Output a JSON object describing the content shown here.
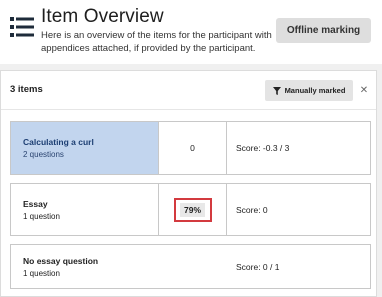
{
  "header": {
    "icon": "list-icon",
    "title": "Item Overview",
    "description": "Here is an overview of the items for the participant with appendices attached, if provided by the participant.",
    "offline_button": "Offline marking"
  },
  "toolbar": {
    "items_count": "3 items",
    "filter_icon": "filter-icon",
    "filter_label": "Manually marked",
    "filter_close": "✕"
  },
  "items": [
    {
      "title": "Calculating a curl",
      "subtitle": "2 questions",
      "count": "0",
      "score": "Score: -0.3 / 3"
    },
    {
      "title": "Essay",
      "subtitle": "1 question",
      "count": "79%",
      "score": "Score: 0"
    },
    {
      "title": "No essay question",
      "subtitle": "1 question",
      "count": "",
      "score": "Score: 0 / 1"
    }
  ],
  "colors": {
    "selected_row": "#c2d5ee",
    "highlight_border": "#d33a3f"
  }
}
